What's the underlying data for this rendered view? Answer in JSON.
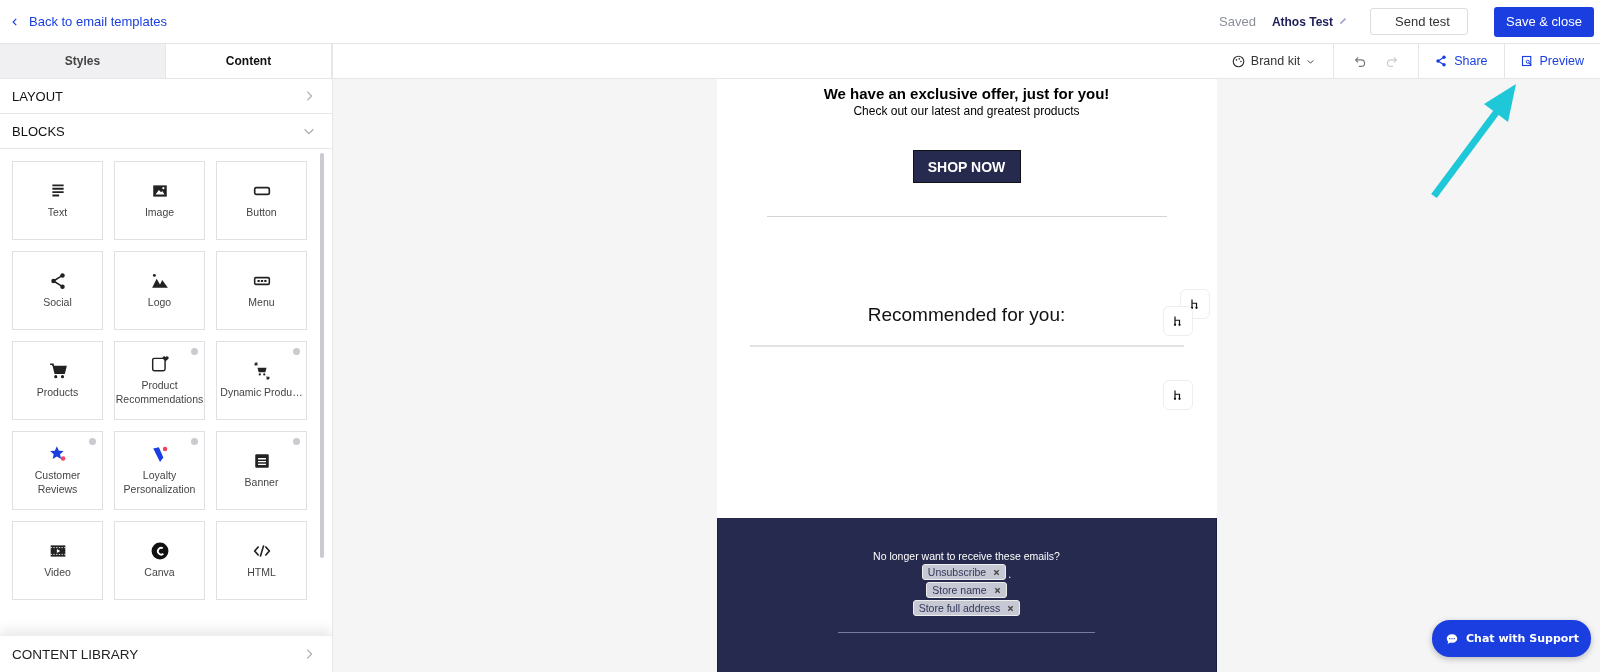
{
  "top_bar": {
    "back_link": "Back to email templates",
    "save_status": "Saved",
    "template_name": "Athos Test",
    "send_test": "Send test",
    "save_button": "Save & close"
  },
  "sidebar": {
    "tabs": [
      {
        "label": "Styles",
        "selected": false
      },
      {
        "label": "Content",
        "selected": true
      }
    ],
    "sections": [
      {
        "title": "LAYOUT",
        "expanded": false
      },
      {
        "title": "BLOCKS",
        "expanded": true
      }
    ],
    "blocks": [
      {
        "label": "Text",
        "info": false
      },
      {
        "label": "Image",
        "info": false
      },
      {
        "label": "Button",
        "info": false
      },
      {
        "label": "Social",
        "info": false
      },
      {
        "label": "Logo",
        "info": false
      },
      {
        "label": "Menu",
        "info": false
      },
      {
        "label": "Products",
        "info": false
      },
      {
        "label": "Product Recommendations",
        "info": true
      },
      {
        "label": "Dynamic Produ…",
        "info": true
      },
      {
        "label": "Customer Reviews",
        "info": true
      },
      {
        "label": "Loyalty Personalization",
        "info": true
      },
      {
        "label": "Banner",
        "info": true
      },
      {
        "label": "Video",
        "info": false
      },
      {
        "label": "Canva",
        "info": false
      },
      {
        "label": "HTML",
        "info": false
      }
    ],
    "library": {
      "title": "CONTENT LIBRARY",
      "expanded": false
    }
  },
  "toolbar": {
    "brand_kit": "Brand kit",
    "undo": {
      "disabled": false
    },
    "redo": {
      "disabled": true
    },
    "share": "Share",
    "preview": "Preview"
  },
  "email": {
    "headline": "We have an exclusive offer, just for you!",
    "subheadline": "Check out our latest and greatest products",
    "cta": "SHOP NOW",
    "section_title": "Recommended for you:",
    "footer": {
      "text": "No longer want to receive these emails?",
      "tags": [
        {
          "label": "Unsubscribe",
          "suffix": "."
        },
        {
          "label": "Store name"
        },
        {
          "label": "Store full address"
        }
      ]
    }
  },
  "chat_button": "Chat with Support"
}
